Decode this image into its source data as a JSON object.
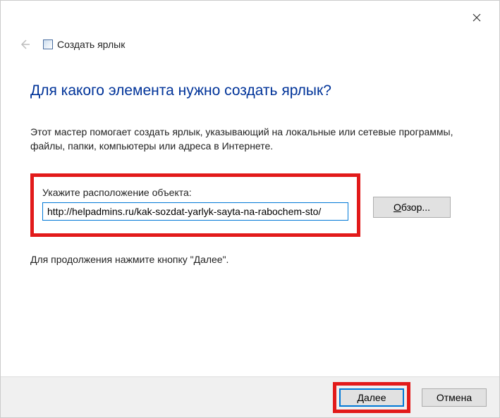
{
  "titlebar": {
    "wizard_name": "Создать ярлык"
  },
  "content": {
    "heading": "Для какого элемента нужно создать ярлык?",
    "description": "Этот мастер помогает создать ярлык, указывающий на локальные или сетевые программы, файлы, папки, компьютеры или адреса в Интернете.",
    "input_label": "Укажите расположение объекта:",
    "input_value": "http://helpadmins.ru/kak-sozdat-yarlyk-sayta-na-rabochem-sto/",
    "browse_label": "Обзор...",
    "continue_text": "Для продолжения нажмите кнопку \"Далее\"."
  },
  "footer": {
    "next_label": "Далее",
    "cancel_label": "Отмена"
  }
}
